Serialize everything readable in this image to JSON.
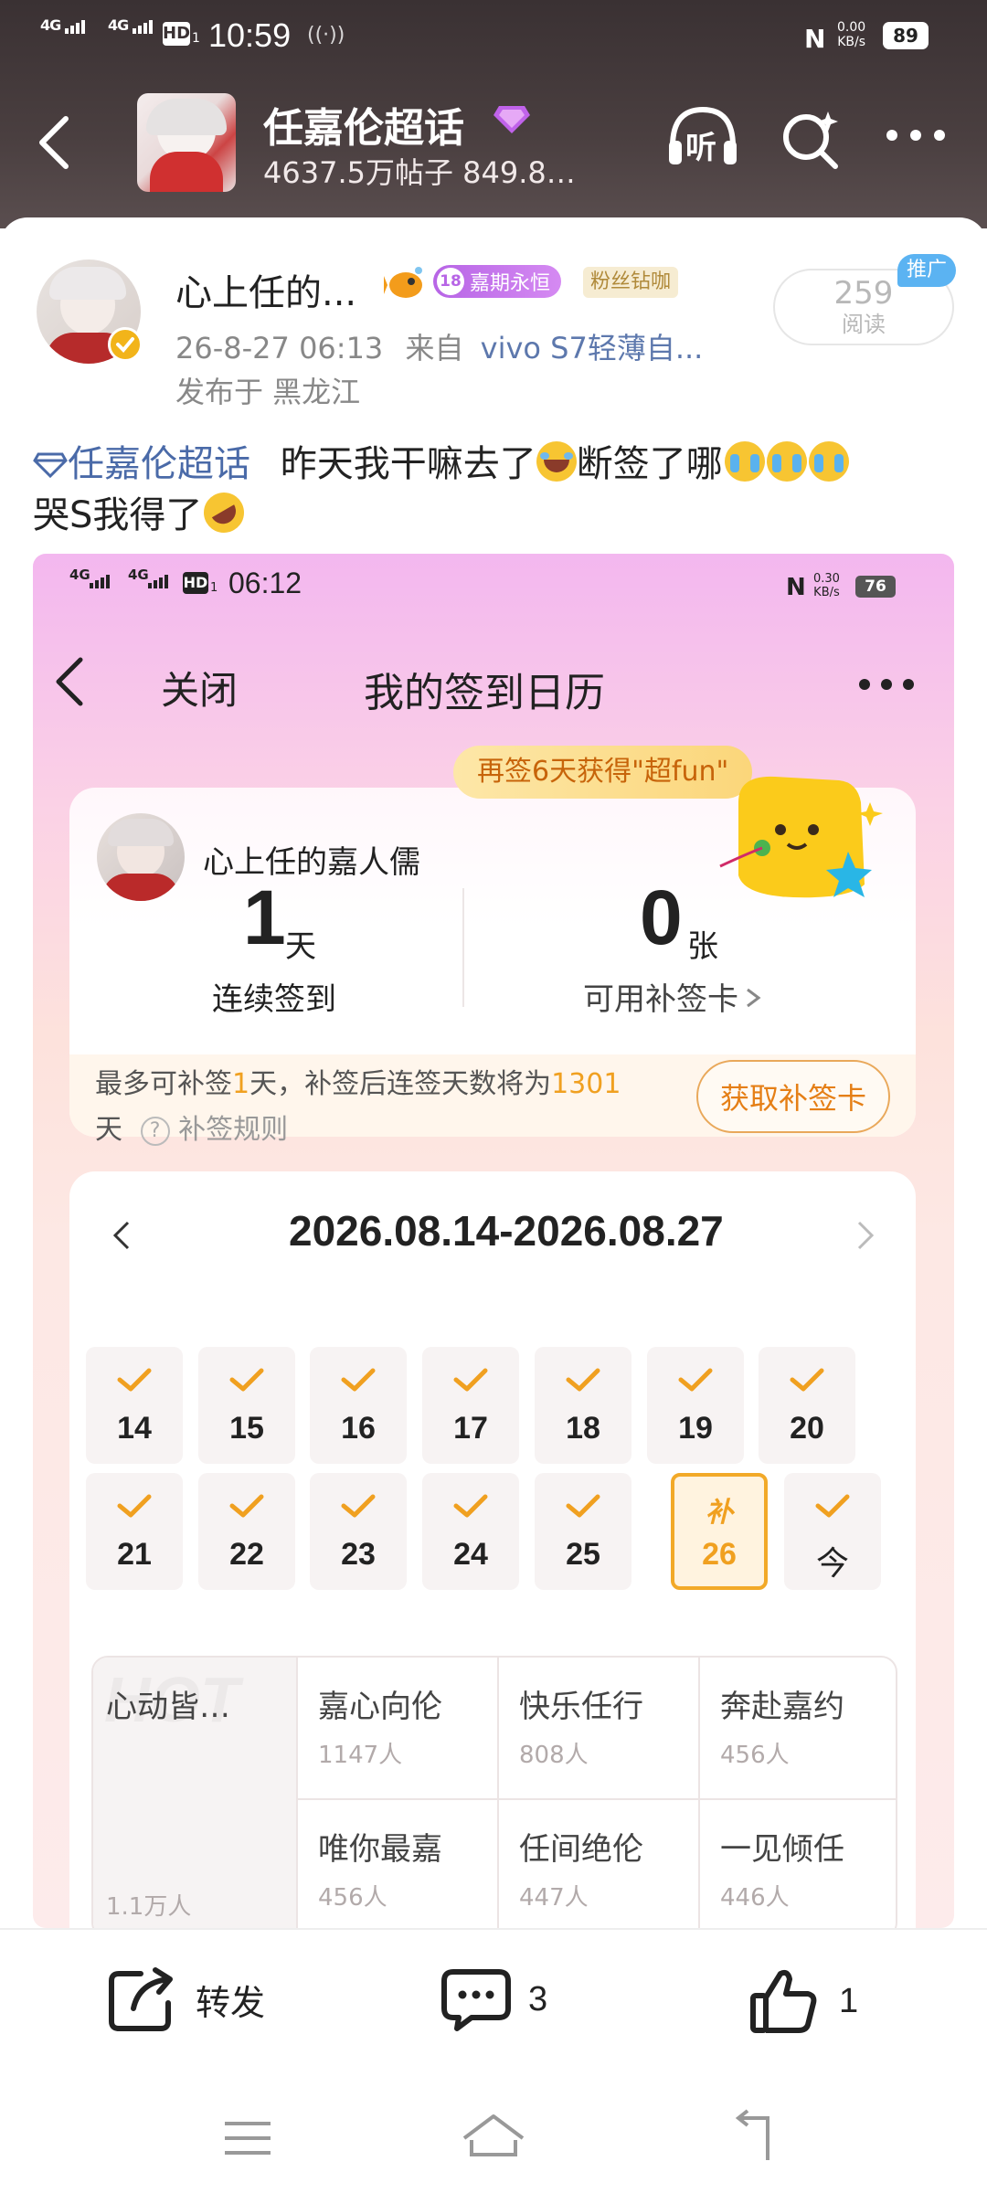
{
  "status_bar": {
    "network1": "4G",
    "network2": "4G",
    "hd": "HD",
    "hd_sub": "1",
    "time": "10:59",
    "speed_value": "0.00",
    "speed_unit": "KB/s",
    "battery": "89"
  },
  "header": {
    "title": "任嘉伦超话",
    "subtitle": "4637.5万帖子 849.8…",
    "listen_label": "听"
  },
  "post": {
    "author": "心上任的...",
    "level_badge": "18",
    "badge_text": "嘉期永恒",
    "fan_badge": "粉丝钻咖",
    "time": "26-8-27 06:13",
    "source_prefix": "来自",
    "source": "vivo S7轻薄自...",
    "location": "发布于 黑龙江",
    "read_count": "259",
    "read_label": "阅读",
    "promo_tag": "推广",
    "topic": "任嘉伦超话",
    "text_part1": "昨天我干嘛去了",
    "text_part2": "断签了哪",
    "text_part3": "哭S我得了"
  },
  "embedded": {
    "status_bar": {
      "network1": "4G",
      "network2": "4G",
      "hd": "HD",
      "hd_sub": "1",
      "time": "06:12",
      "speed_value": "0.30",
      "speed_unit": "KB/s",
      "battery": "76"
    },
    "nav": {
      "close_label": "关闭",
      "title": "我的签到日历"
    },
    "reward_banner": "再签6天获得\"超fun\"",
    "user_name": "心上任的嘉人儒",
    "streak_value": "1",
    "streak_unit": "天",
    "streak_label": "连续签到",
    "cards_value": "0",
    "cards_unit": "张",
    "cards_label": "可用补签卡",
    "notice_a": "最多可补签",
    "notice_b": "1",
    "notice_c": "天，补签后连签天数将为",
    "notice_d": "1301",
    "notice_e": "天",
    "rules_label": "补签规则",
    "get_card_label": "获取补签卡",
    "date_range": "2026.08.14-2026.08.27",
    "week1": [
      "14",
      "15",
      "16",
      "17",
      "18",
      "19",
      "20"
    ],
    "week2": [
      "21",
      "22",
      "23",
      "24",
      "25"
    ],
    "makeup_mark": "补",
    "makeup_day": "26",
    "today_label": "今",
    "hot_watermark": "HOT",
    "groups": [
      {
        "name": "心动皆…",
        "count": "1.1万人"
      },
      {
        "name": "嘉心向伦",
        "count": "1147人"
      },
      {
        "name": "快乐任行",
        "count": "808人"
      },
      {
        "name": "奔赴嘉约",
        "count": "456人"
      },
      {
        "name": "唯你最嘉",
        "count": "456人"
      },
      {
        "name": "任间绝伦",
        "count": "447人"
      },
      {
        "name": "一见倾任",
        "count": "446人"
      }
    ]
  },
  "actions": {
    "share_label": "转发",
    "comment_count": "3",
    "like_count": "1"
  },
  "colors": {
    "accent_orange": "#f0a020",
    "link_blue": "#4a6aa8",
    "badge_purple": "#b765e6"
  }
}
